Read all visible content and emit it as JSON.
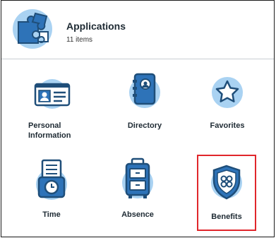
{
  "header": {
    "title": "Applications",
    "subtitle": "11 items",
    "icon": "puzzle-icon"
  },
  "apps": [
    {
      "label": "Personal\nInformation",
      "icon": "id-card-icon"
    },
    {
      "label": "Directory",
      "icon": "directory-book-icon"
    },
    {
      "label": "Favorites",
      "icon": "star-icon"
    },
    {
      "label": "Time",
      "icon": "time-clock-icon"
    },
    {
      "label": "Absence",
      "icon": "luggage-icon"
    },
    {
      "label": "Benefits",
      "icon": "shield-icon"
    }
  ],
  "colors": {
    "icon_dark": "#1f4e79",
    "icon_mid": "#2e73b8",
    "icon_light": "#a9d2f2",
    "highlight": "#e0262b"
  }
}
